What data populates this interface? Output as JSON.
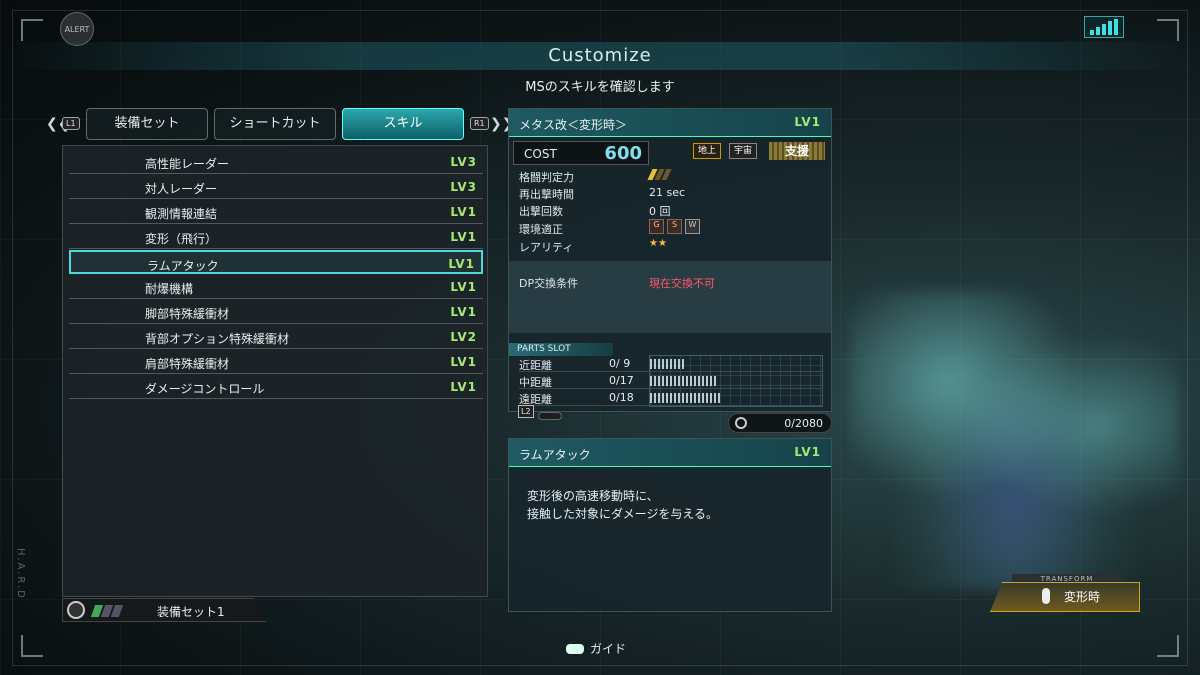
{
  "header": {
    "alert_label": "ALERT",
    "title": "Customize",
    "subtitle": "MSのスキルを確認します"
  },
  "tabs": {
    "left_button": "L1",
    "right_button": "R1",
    "items": [
      {
        "label": "装備セット"
      },
      {
        "label": "ショートカット"
      },
      {
        "label": "スキル"
      }
    ],
    "active_index": 2
  },
  "skills": [
    {
      "name": "高性能レーダー",
      "level": "LV3"
    },
    {
      "name": "対人レーダー",
      "level": "LV3"
    },
    {
      "name": "観測情報連結",
      "level": "LV1"
    },
    {
      "name": "変形（飛行）",
      "level": "LV1"
    },
    {
      "name": "ラムアタック",
      "level": "LV1"
    },
    {
      "name": "耐爆機構",
      "level": "LV1"
    },
    {
      "name": "脚部特殊緩衝材",
      "level": "LV1"
    },
    {
      "name": "背部オプション特殊緩衝材",
      "level": "LV2"
    },
    {
      "name": "肩部特殊緩衝材",
      "level": "LV1"
    },
    {
      "name": "ダメージコントロール",
      "level": "LV1"
    }
  ],
  "selected_skill_index": 4,
  "loadout": {
    "label": "装備セット1",
    "gauge_filled": 1,
    "gauge_total": 3
  },
  "unit": {
    "name": "メタス改＜変形時＞",
    "level": "LV1",
    "cost_label": "COST",
    "cost_value": "600",
    "env_ground": "地上",
    "env_space": "宇宙",
    "role": "支援",
    "stats": {
      "melee_label": "格闘判定力",
      "melee_level": 1,
      "melee_max": 3,
      "respawn_label": "再出撃時間",
      "respawn_value": "21 sec",
      "sortie_label": "出撃回数",
      "sortie_value": "0 回",
      "env_label": "環境適正",
      "env_grades": [
        "G",
        "S",
        "W"
      ],
      "rarity_label": "レアリティ",
      "rarity_value": "★★"
    },
    "dp_label": "DP交換条件",
    "dp_value": "現在交換不可",
    "parts_slot_label": "PARTS SLOT",
    "parts": [
      {
        "label": "近距離",
        "value": "0/ 9",
        "slots": 9
      },
      {
        "label": "中距離",
        "value": "0/17",
        "slots": 17
      },
      {
        "label": "遠距離",
        "value": "0/18",
        "slots": 18
      }
    ],
    "l2_label": "L2",
    "capacity": "0/2080"
  },
  "description": {
    "name": "ラムアタック",
    "level": "LV1",
    "text_line1": "変形後の高速移動時に、",
    "text_line2": "接触した対象にダメージを与える。"
  },
  "transform": {
    "caption": "TRANSFORM",
    "label": "変形時"
  },
  "footer": {
    "guide_label": "ガイド"
  },
  "side_text": "H.A.R.D",
  "colors": {
    "accent": "#4ed6dc",
    "level_green": "#a6e870",
    "cost_blue": "#7ee0f0",
    "warning_red": "#ff5a6e"
  }
}
